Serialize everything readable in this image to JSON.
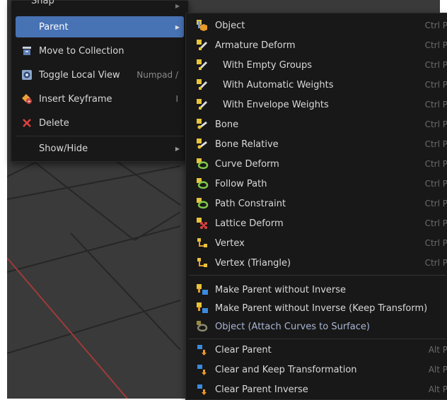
{
  "colors": {
    "highlight": "#4772b3",
    "menu_bg": "#181818",
    "viewport_bg": "#3a3a3a",
    "grid": "#262626",
    "x_axis": "#a03a3a"
  },
  "left_menu": {
    "top_partial_label": "Snap",
    "items": [
      {
        "label": "Parent",
        "icon": "none",
        "shortcut": "",
        "submenu": true
      },
      {
        "label": "Move to Collection",
        "icon": "collection-icon",
        "shortcut": ""
      },
      {
        "label": "Toggle Local View",
        "icon": "local-view-icon",
        "shortcut": "Numpad /"
      },
      {
        "label": "Insert Keyframe",
        "icon": "keyframe-icon",
        "shortcut": "I"
      },
      {
        "label": "Delete",
        "icon": "delete-x-icon",
        "shortcut": ""
      },
      {
        "label": "Show/Hide",
        "icon": "none",
        "shortcut": "",
        "submenu": true
      }
    ]
  },
  "right_menu": {
    "items": [
      {
        "label": "Object",
        "icon": "object-parent-icon",
        "shortcut": "Ctrl P"
      },
      {
        "label": "Armature Deform",
        "icon": "armature-icon",
        "shortcut": "Ctrl P"
      },
      {
        "label": "With Empty Groups",
        "icon": "armature-icon",
        "shortcut": "Ctrl P"
      },
      {
        "label": "With Automatic Weights",
        "icon": "armature-icon",
        "shortcut": "Ctrl P"
      },
      {
        "label": "With Envelope Weights",
        "icon": "armature-icon",
        "shortcut": "Ctrl P"
      },
      {
        "label": "Bone",
        "icon": "bone-icon",
        "shortcut": "Ctrl P"
      },
      {
        "label": "Bone Relative",
        "icon": "bone-icon",
        "shortcut": "Ctrl P"
      },
      {
        "label": "Curve Deform",
        "icon": "curve-icon",
        "shortcut": "Ctrl P"
      },
      {
        "label": "Follow Path",
        "icon": "curve-icon",
        "shortcut": "Ctrl P"
      },
      {
        "label": "Path Constraint",
        "icon": "curve-icon",
        "shortcut": "Ctrl P"
      },
      {
        "label": "Lattice Deform",
        "icon": "lattice-icon",
        "shortcut": "Ctrl P"
      },
      {
        "label": "Vertex",
        "icon": "vertex-icon",
        "shortcut": "Ctrl P"
      },
      {
        "label": "Vertex (Triangle)",
        "icon": "vertex-icon",
        "shortcut": "Ctrl P"
      },
      {
        "label": "Make Parent without Inverse",
        "icon": "parent-no-inverse-icon",
        "shortcut": ""
      },
      {
        "label": "Make Parent without Inverse (Keep Transform)",
        "icon": "parent-no-inverse-icon",
        "shortcut": ""
      },
      {
        "label": "Object (Attach Curves to Surface)",
        "icon": "curves-surface-icon",
        "shortcut": ""
      },
      {
        "label": "Clear Parent",
        "icon": "clear-parent-icon",
        "shortcut": "Alt P"
      },
      {
        "label": "Clear and Keep Transformation",
        "icon": "clear-parent-icon",
        "shortcut": "Alt P"
      },
      {
        "label": "Clear Parent Inverse",
        "icon": "clear-parent-icon",
        "shortcut": "Alt P"
      }
    ]
  }
}
